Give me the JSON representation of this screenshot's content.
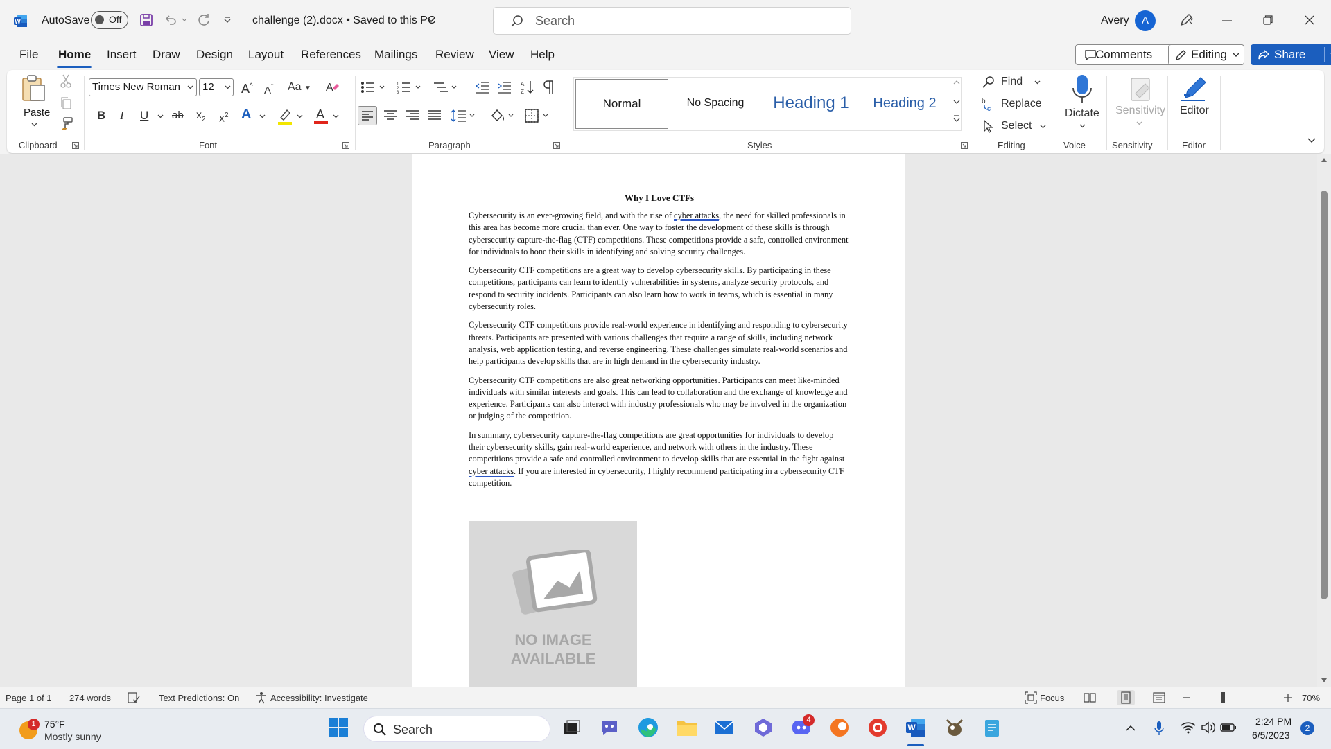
{
  "window": {
    "autosave_label": "AutoSave",
    "autosave_state": "Off",
    "doc_title": "challenge (2).docx • Saved to this PC",
    "search_placeholder": "Search",
    "user_name": "Avery",
    "user_initial": "A"
  },
  "tabs": [
    "File",
    "Home",
    "Insert",
    "Draw",
    "Design",
    "Layout",
    "References",
    "Mailings",
    "Review",
    "View",
    "Help"
  ],
  "active_tab": "Home",
  "tab_actions": {
    "comments": "Comments",
    "editing": "Editing",
    "share": "Share"
  },
  "ribbon": {
    "clipboard": {
      "paste": "Paste",
      "group": "Clipboard"
    },
    "font": {
      "family": "Times New Roman",
      "size": "12",
      "group": "Font",
      "case_label": "Aa"
    },
    "paragraph": {
      "group": "Paragraph"
    },
    "styles": {
      "items": [
        "Normal",
        "No Spacing",
        "Heading 1",
        "Heading 2"
      ],
      "selected": "Normal",
      "group": "Styles"
    },
    "editing": {
      "find": "Find",
      "replace": "Replace",
      "select": "Select",
      "group": "Editing"
    },
    "voice": {
      "dictate": "Dictate",
      "group": "Voice"
    },
    "sensitivity": {
      "label": "Sensitivity",
      "group": "Sensitivity"
    },
    "editor": {
      "label": "Editor",
      "group": "Editor"
    },
    "colors": {
      "highlight": "#f2e600",
      "font_color": "#e0251b",
      "accent": "#1b5ebe"
    }
  },
  "document": {
    "title": "Why I Love CTFs",
    "p1_a": "Cybersecurity is an ever-growing field, and with the rise of ",
    "p1_link": "cyber attacks",
    "p1_b": ", the need for skilled professionals in this area has become more crucial than ever. One way to foster the development of these skills is through cybersecurity capture-the-flag (CTF) competitions. These competitions provide a safe, controlled environment for individuals to hone their skills in identifying and solving security challenges.",
    "p2": "Cybersecurity CTF competitions are a great way to develop cybersecurity skills. By participating in these competitions, participants can learn to identify vulnerabilities in systems, analyze security protocols, and respond to security incidents. Participants can also learn how to work in teams, which is essential in many cybersecurity roles.",
    "p3": "Cybersecurity CTF competitions provide real-world experience in identifying and responding to cybersecurity threats. Participants are presented with various challenges that require a range of skills, including network analysis, web application testing, and reverse engineering. These challenges simulate real-world scenarios and help participants develop skills that are in high demand in the cybersecurity industry.",
    "p4": "Cybersecurity CTF competitions are also great networking opportunities. Participants can meet like-minded individuals with similar interests and goals. This can lead to collaboration and the exchange of knowledge and experience. Participants can also interact with industry professionals who may be involved in the organization or judging of the competition.",
    "p5_a": "In summary, cybersecurity capture-the-flag competitions are great opportunities for individuals to develop their cybersecurity skills, gain real-world experience, and network with others in the industry. These competitions provide a safe and controlled environment to develop skills that are essential in the fight against ",
    "p5_link": "cyber attacks",
    "p5_b": ". If you are interested in cybersecurity, I highly recommend participating in a cybersecurity CTF competition.",
    "image_text_1": "NO IMAGE",
    "image_text_2": "AVAILABLE"
  },
  "status": {
    "page": "Page 1 of 1",
    "words": "274 words",
    "predictions": "Text Predictions: On",
    "accessibility": "Accessibility: Investigate",
    "focus": "Focus",
    "zoom": "70%"
  },
  "taskbar": {
    "temperature": "75°F",
    "weather": "Mostly sunny",
    "weather_badge": "1",
    "search": "Search",
    "discord_badge": "4",
    "time": "2:24 PM",
    "date": "6/5/2023",
    "notifications": "2"
  }
}
